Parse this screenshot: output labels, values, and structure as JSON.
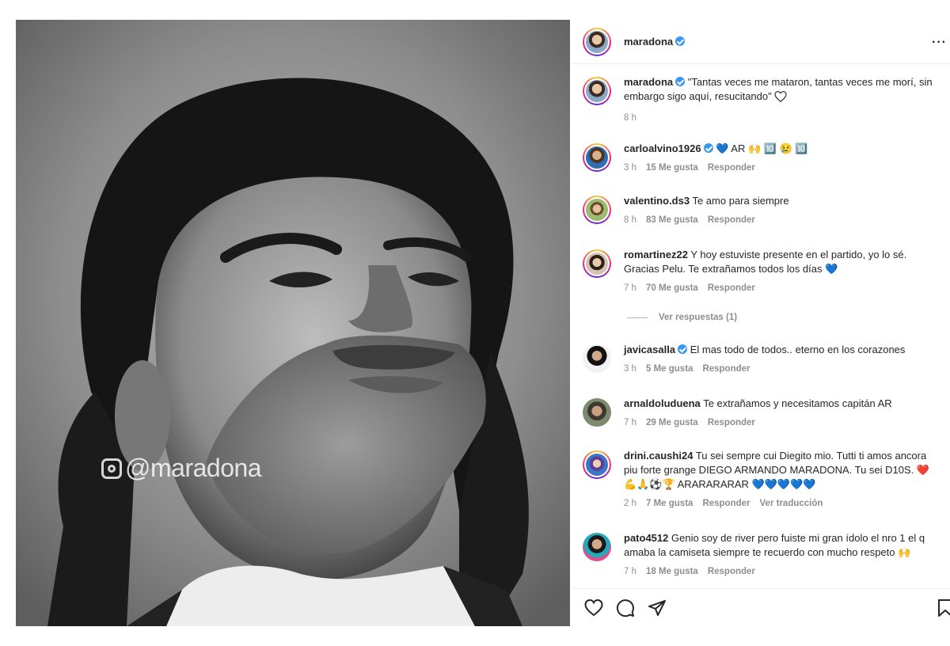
{
  "post": {
    "username": "maradona",
    "watermark": "@maradona",
    "more_label": "···"
  },
  "caption": {
    "username": "maradona",
    "text": "\"Tantas veces me mataron, tantas veces me morí, sin embargo sigo aquí, resucitando\"",
    "time": "8 h"
  },
  "comments": [
    {
      "username": "carloalvino1926",
      "verified": true,
      "text": "💙 AR 🙌 🔟 😢 🔟",
      "time": "3 h",
      "likes": "15 Me gusta",
      "reply": "Responder"
    },
    {
      "username": "valentino.ds3",
      "verified": false,
      "text": "Te amo para siempre",
      "time": "8 h",
      "likes": "83 Me gusta",
      "reply": "Responder"
    },
    {
      "username": "romartinez22",
      "verified": false,
      "text": "Y hoy estuviste presente en el partido, yo lo sé. Gracias Pelu. Te extrañamos todos los días 💙",
      "time": "7 h",
      "likes": "70 Me gusta",
      "reply": "Responder",
      "view_replies": "Ver respuestas (1)"
    },
    {
      "username": "javicasalla",
      "verified": true,
      "text": "El mas todo de todos.. eterno en los corazones",
      "time": "3 h",
      "likes": "5 Me gusta",
      "reply": "Responder"
    },
    {
      "username": "arnaldoluduena",
      "verified": false,
      "text": "Te extrañamos y necesitamos capitán AR",
      "time": "7 h",
      "likes": "29 Me gusta",
      "reply": "Responder"
    },
    {
      "username": "drini.caushi24",
      "verified": false,
      "text": "Tu sei sempre cui Diegito mio. Tutti ti amos ancora piu forte grange DIEGO ARMANDO MARADONA. Tu sei D10S. ❤️💪🙏⚽🏆 ARARARARAR 💙💙💙💙💙",
      "time": "2 h",
      "likes": "7 Me gusta",
      "reply": "Responder",
      "translate": "Ver traducción"
    },
    {
      "username": "pato4512",
      "verified": false,
      "text": "Genio soy de river pero fuiste mi gran ídolo el nro 1 el q amaba la camiseta siempre te recuerdo con mucho respeto 🙌",
      "time": "7 h",
      "likes": "18 Me gusta",
      "reply": "Responder"
    }
  ],
  "actions": {
    "like": "heart-icon",
    "comment": "comment-icon",
    "share": "share-icon",
    "save": "bookmark-icon"
  },
  "colors": {
    "verified": "#3897f0",
    "meta_text": "#8e8e8e",
    "primary_text": "#262626"
  }
}
